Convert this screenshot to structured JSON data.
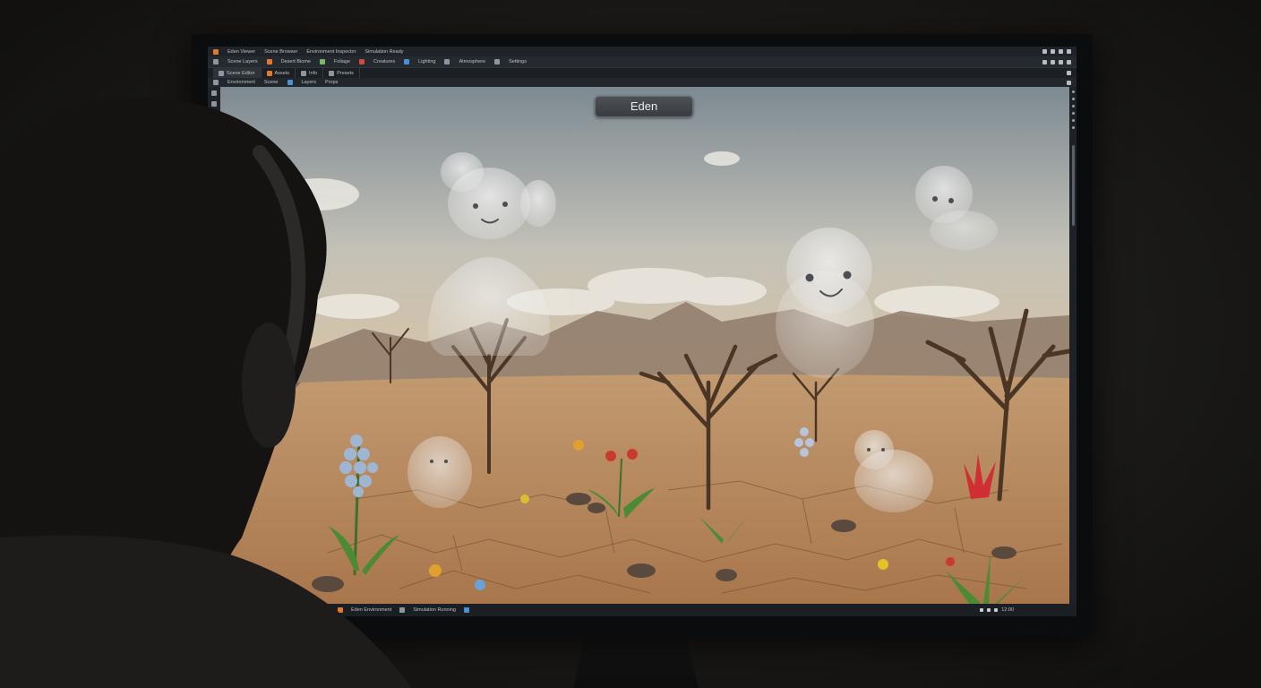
{
  "window": {
    "title_items": [
      "Eden Viewer",
      "Scene Browser",
      "Environment Inspector",
      "Simulation Ready"
    ],
    "toolbar_items": [
      "Scene Layers",
      "Desert Biome",
      "Foliage",
      "Creatures",
      "Lighting",
      "Atmosphere",
      "Settings"
    ],
    "tabs": [
      "Scene Editor",
      "Assets",
      "Info",
      "Presets"
    ],
    "path_items": [
      "Environment",
      "Scene",
      "Layers",
      "Props"
    ]
  },
  "viewport": {
    "scene_title": "Eden"
  },
  "statusbar": {
    "items": [
      "Eden Environment",
      "Simulation Running"
    ],
    "clock": "12:00"
  },
  "colors": {
    "chrome_dark": "#1f2327",
    "sky_top": "#9aa3a8",
    "ground": "#b98a5c",
    "accent_orange": "#e07a2e"
  }
}
